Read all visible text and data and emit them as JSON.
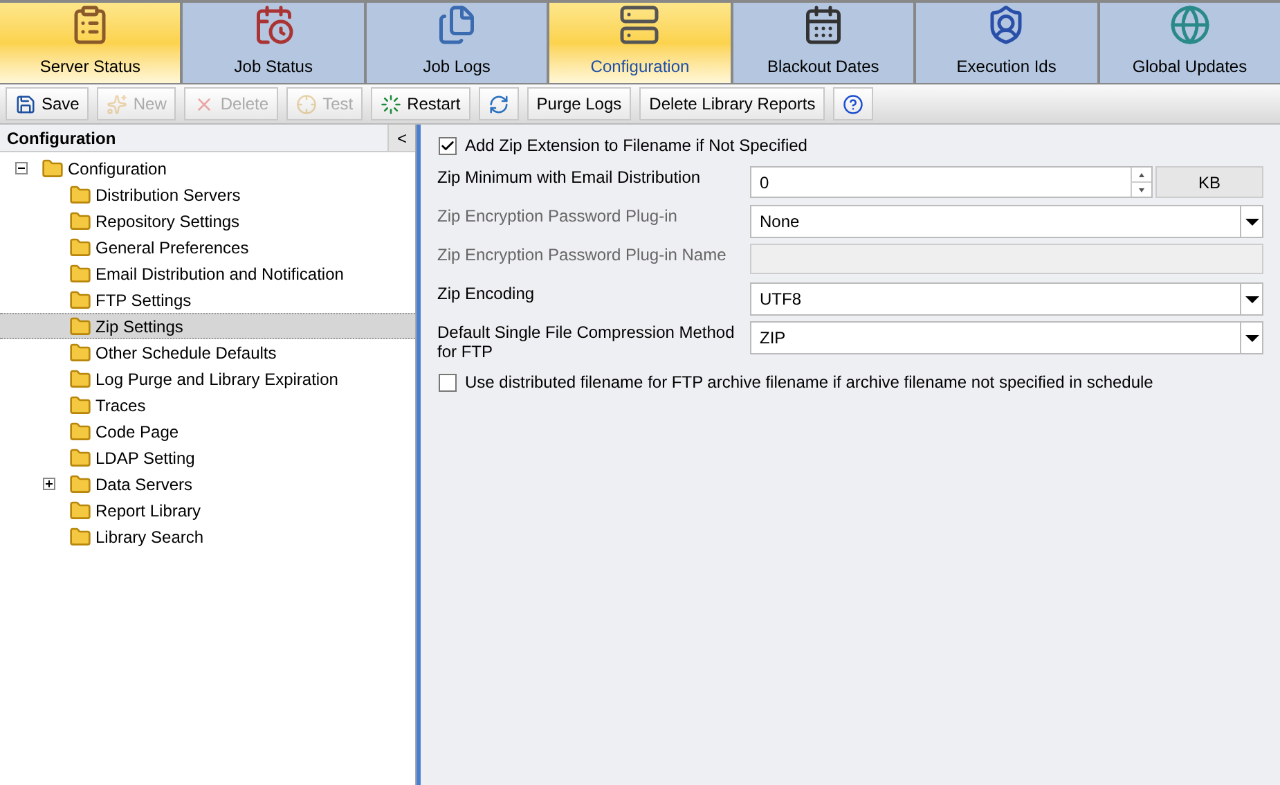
{
  "tabs": [
    {
      "label": "Server Status",
      "selected": false,
      "highlight": true
    },
    {
      "label": "Job Status",
      "selected": false,
      "highlight": false
    },
    {
      "label": "Job Logs",
      "selected": false,
      "highlight": false
    },
    {
      "label": "Configuration",
      "selected": true,
      "highlight": true
    },
    {
      "label": "Blackout Dates",
      "selected": false,
      "highlight": false
    },
    {
      "label": "Execution Ids",
      "selected": false,
      "highlight": false
    },
    {
      "label": "Global Updates",
      "selected": false,
      "highlight": false
    }
  ],
  "toolbar": [
    {
      "kind": "button",
      "label": "Save",
      "disabled": false
    },
    {
      "kind": "button",
      "label": "New",
      "disabled": true
    },
    {
      "kind": "button",
      "label": "Delete",
      "disabled": true
    },
    {
      "kind": "button",
      "label": "Test",
      "disabled": true
    },
    {
      "kind": "button",
      "label": "Restart",
      "disabled": false
    },
    {
      "kind": "icon",
      "disabled": false
    },
    {
      "kind": "button",
      "label": "Purge Logs",
      "disabled": false
    },
    {
      "kind": "button",
      "label": "Delete Library Reports",
      "disabled": false
    },
    {
      "kind": "icon",
      "disabled": false
    }
  ],
  "sidebar": {
    "title": "Configuration",
    "collapse": "<",
    "tree": [
      {
        "label": "Configuration",
        "expanded": true,
        "selected": false,
        "children": [
          {
            "label": "Distribution Servers",
            "selected": false
          },
          {
            "label": "Repository Settings",
            "selected": false
          },
          {
            "label": "General Preferences",
            "selected": false
          },
          {
            "label": "Email Distribution and Notification",
            "selected": false
          },
          {
            "label": "FTP Settings",
            "selected": false
          },
          {
            "label": "Zip Settings",
            "selected": true
          },
          {
            "label": "Other Schedule Defaults",
            "selected": false
          },
          {
            "label": "Log Purge and Library Expiration",
            "selected": false
          },
          {
            "label": "Traces",
            "selected": false
          },
          {
            "label": "Code Page",
            "selected": false
          },
          {
            "label": "LDAP Setting",
            "selected": false
          },
          {
            "label": "Data Servers",
            "selected": false,
            "expanded": false,
            "expandable": true
          },
          {
            "label": "Report Library",
            "selected": false
          },
          {
            "label": "Library Search",
            "selected": false
          }
        ]
      }
    ]
  },
  "form": [
    {
      "kind": "checkbox",
      "label": "Add Zip Extension to Filename if Not Specified",
      "checked": true
    },
    {
      "kind": "spinner",
      "label": "Zip Minimum with Email Distribution",
      "value": "0",
      "unit": "KB",
      "dimmed": false
    },
    {
      "kind": "select",
      "label": "Zip Encryption Password Plug-in",
      "value": "None",
      "dimmed": true
    },
    {
      "kind": "text",
      "label": "Zip Encryption Password Plug-in Name",
      "dimmed": true,
      "disabled": true
    },
    {
      "kind": "select",
      "label": "Zip Encoding",
      "value": "UTF8",
      "dimmed": false
    },
    {
      "kind": "select",
      "label": "Default Single File Compression Method for FTP",
      "value": "ZIP",
      "dimmed": false
    },
    {
      "kind": "checkbox",
      "label": "Use distributed filename for FTP archive filename if archive filename not specified in schedule",
      "checked": false
    }
  ]
}
